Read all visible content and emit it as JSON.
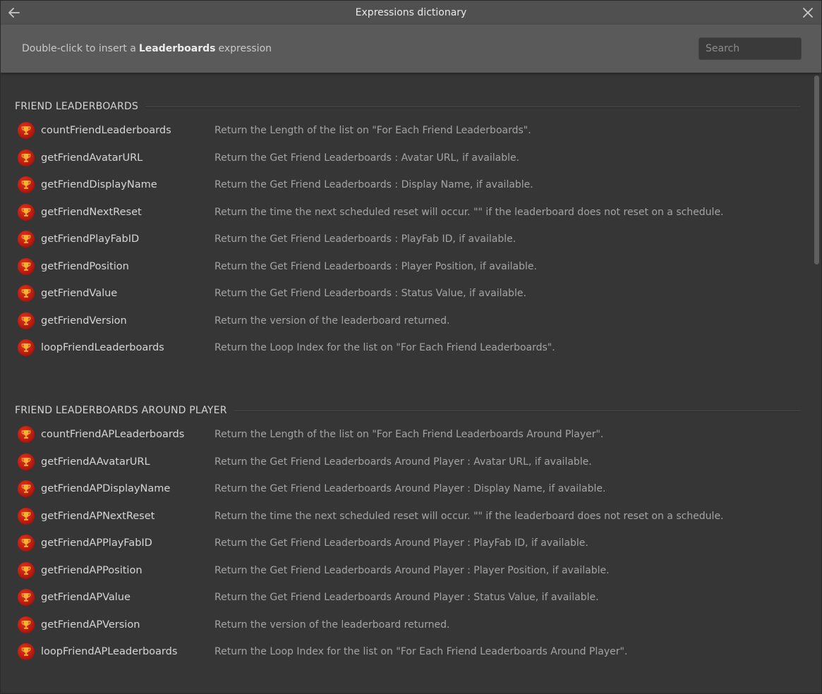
{
  "window": {
    "title": "Expressions dictionary"
  },
  "subheader": {
    "prefix": "Double-click to insert a",
    "category": "Leaderboards",
    "suffix": "expression"
  },
  "search": {
    "placeholder": "Search"
  },
  "sections": [
    {
      "title": "FRIEND LEADERBOARDS",
      "items": [
        {
          "name": "countFriendLeaderboards",
          "desc": "Return the Length of the list on \"For Each Friend Leaderboards\"."
        },
        {
          "name": "getFriendAvatarURL",
          "desc": "Return the Get Friend Leaderboards : Avatar URL, if available."
        },
        {
          "name": "getFriendDisplayName",
          "desc": "Return the Get Friend Leaderboards : Display Name, if available."
        },
        {
          "name": "getFriendNextReset",
          "desc": "Return the time the next scheduled reset will occur. \"\" if the leaderboard does not reset on a schedule."
        },
        {
          "name": "getFriendPlayFabID",
          "desc": "Return the Get Friend Leaderboards : PlayFab ID, if available."
        },
        {
          "name": "getFriendPosition",
          "desc": "Return the Get Friend Leaderboards : Player Position, if available."
        },
        {
          "name": "getFriendValue",
          "desc": "Return the Get Friend Leaderboards : Status Value, if available."
        },
        {
          "name": "getFriendVersion",
          "desc": "Return the version of the leaderboard returned."
        },
        {
          "name": "loopFriendLeaderboards",
          "desc": "Return the Loop Index for the list on \"For Each Friend Leaderboards\"."
        }
      ]
    },
    {
      "title": "FRIEND LEADERBOARDS AROUND PLAYER",
      "items": [
        {
          "name": "countFriendAPLeaderboards",
          "desc": "Return the Length of the list on \"For Each Friend Leaderboards Around Player\"."
        },
        {
          "name": "getFriendAAvatarURL",
          "desc": "Return the Get Friend Leaderboards Around Player : Avatar URL, if available."
        },
        {
          "name": "getFriendAPDisplayName",
          "desc": "Return the Get Friend Leaderboards Around Player : Display Name, if available."
        },
        {
          "name": "getFriendAPNextReset",
          "desc": "Return the time the next scheduled reset will occur. \"\" if the leaderboard does not reset on a schedule."
        },
        {
          "name": "getFriendAPPlayFabID",
          "desc": "Return the Get Friend Leaderboards Around Player : PlayFab ID, if available."
        },
        {
          "name": "getFriendAPPosition",
          "desc": "Return the Get Friend Leaderboards Around Player : Player Position, if available."
        },
        {
          "name": "getFriendAPValue",
          "desc": "Return the Get Friend Leaderboards Around Player : Status Value, if available."
        },
        {
          "name": "getFriendAPVersion",
          "desc": "Return the version of the leaderboard returned."
        },
        {
          "name": "loopFriendAPLeaderboards",
          "desc": "Return the Loop Index for the list on \"For Each Friend Leaderboards Around Player\"."
        }
      ]
    }
  ],
  "icons": {
    "back": "arrow-left-icon",
    "close": "close-icon",
    "item": "trophy-icon"
  },
  "colors": {
    "icon_red": "#c21f12",
    "trophy_gold": "#f2b233"
  }
}
